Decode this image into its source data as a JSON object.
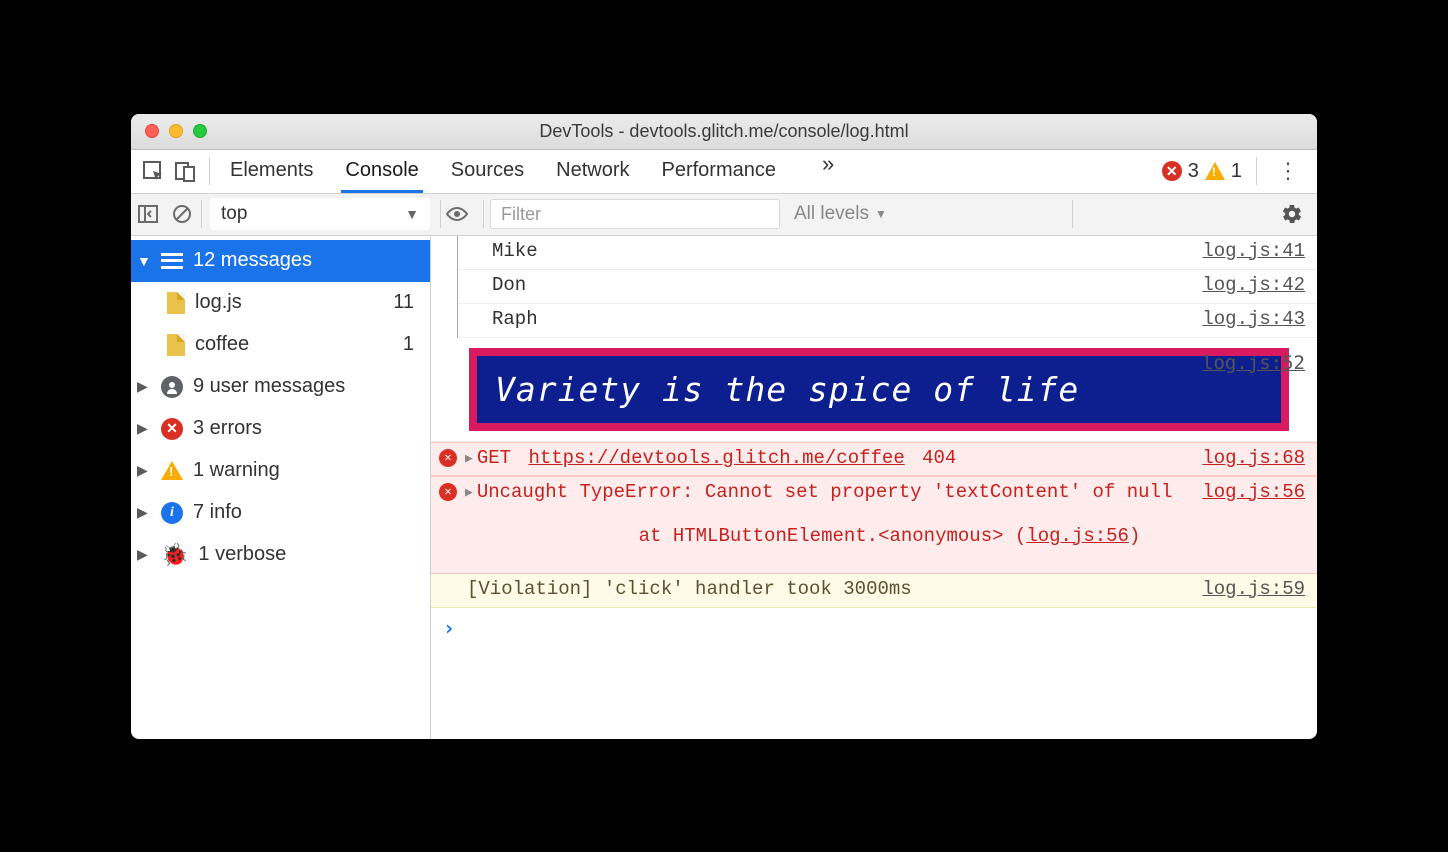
{
  "window": {
    "title": "DevTools - devtools.glitch.me/console/log.html"
  },
  "tabs": {
    "items": [
      "Elements",
      "Console",
      "Sources",
      "Network",
      "Performance"
    ],
    "active": 1,
    "errors": "3",
    "warnings": "1"
  },
  "filterbar": {
    "context": "top",
    "filter_placeholder": "Filter",
    "levels": "All levels"
  },
  "sidebar": {
    "messages": {
      "label": "12 messages"
    },
    "files": [
      {
        "name": "log.js",
        "count": "11"
      },
      {
        "name": "coffee",
        "count": "1"
      }
    ],
    "groups": [
      {
        "icon": "user",
        "label": "9 user messages"
      },
      {
        "icon": "error",
        "label": "3 errors"
      },
      {
        "icon": "warning",
        "label": "1 warning"
      },
      {
        "icon": "info",
        "label": "7 info"
      },
      {
        "icon": "verbose",
        "label": "1 verbose"
      }
    ]
  },
  "logs": {
    "rows": [
      {
        "text": "Mike",
        "src": "log.js:41"
      },
      {
        "text": "Don",
        "src": "log.js:42"
      },
      {
        "text": "Raph",
        "src": "log.js:43"
      }
    ],
    "banner": {
      "text": "Variety is the spice of life",
      "src": "log.js:52"
    },
    "net_error": {
      "method": "GET",
      "url": "https://devtools.glitch.me/coffee",
      "status": "404",
      "src": "log.js:68"
    },
    "exception": {
      "head": "Uncaught TypeError: Cannot set property 'textContent' of null",
      "stack_prefix": "    at HTMLButtonElement.<anonymous> (",
      "stack_link": "log.js:56",
      "stack_suffix": ")",
      "src": "log.js:56"
    },
    "violation": {
      "text": "[Violation] 'click' handler took 3000ms",
      "src": "log.js:59"
    }
  }
}
